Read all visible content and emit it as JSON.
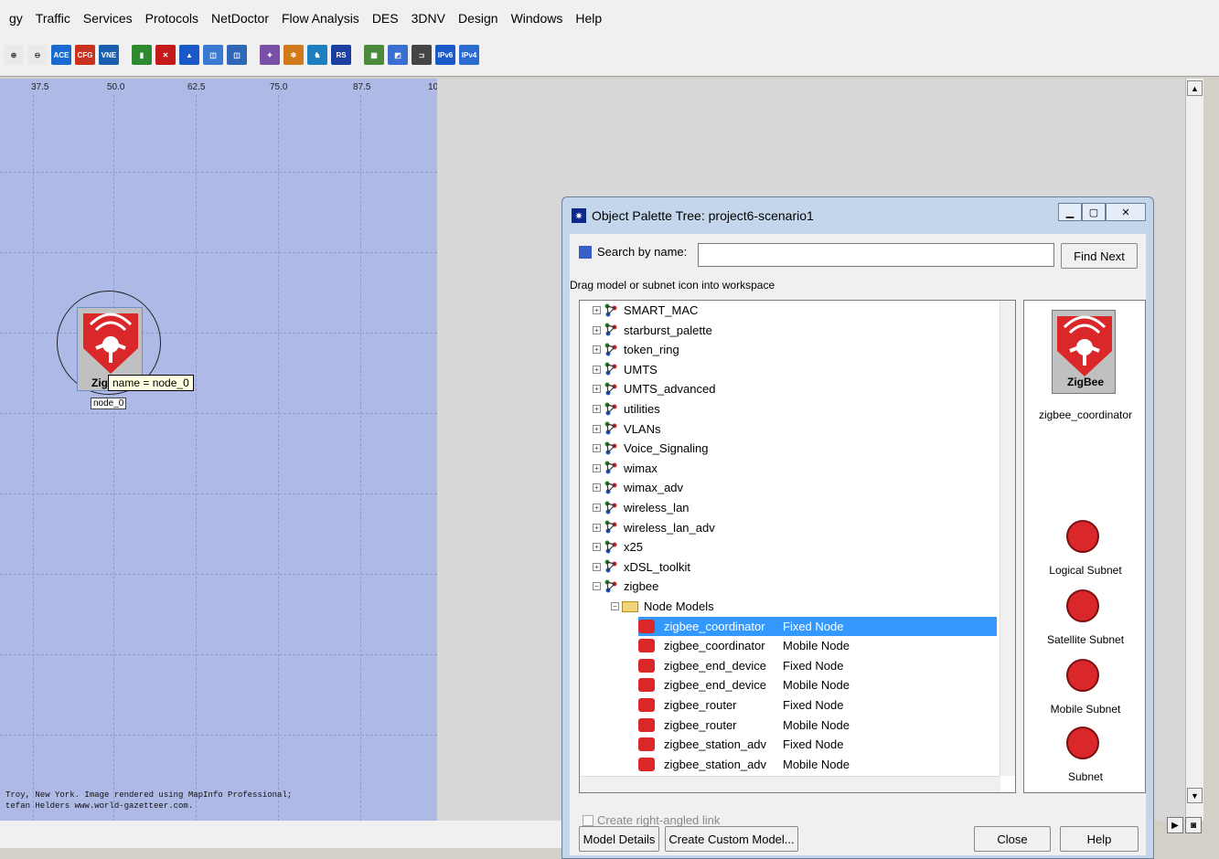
{
  "menu": [
    "gy",
    "Traffic",
    "Services",
    "Protocols",
    "NetDoctor",
    "Flow Analysis",
    "DES",
    "3DNV",
    "Design",
    "Windows",
    "Help"
  ],
  "toolbar": {
    "icons": [
      {
        "name": "zoom-in-icon",
        "color": "#eaeaea",
        "label": "⊕"
      },
      {
        "name": "zoom-out-icon",
        "color": "#eaeaea",
        "label": "⊖"
      },
      {
        "name": "ace-icon",
        "color": "#1a6bd1",
        "label": "ACE"
      },
      {
        "name": "cfg-icon",
        "color": "#c8321e",
        "label": "CFG"
      },
      {
        "name": "vne-icon",
        "color": "#1a5fb0",
        "label": "VNE"
      },
      {
        "name": "sep"
      },
      {
        "name": "traffic-light-icon",
        "color": "#2f8a2f",
        "label": "▮"
      },
      {
        "name": "fail-node-icon",
        "color": "#c61a1a",
        "label": "✕"
      },
      {
        "name": "triangle-icon",
        "color": "#1a58c8",
        "label": "▲"
      },
      {
        "name": "topology-icon",
        "color": "#3a7ad1",
        "label": "◫"
      },
      {
        "name": "topology-config-icon",
        "color": "#2e66b8",
        "label": "◫"
      },
      {
        "name": "sep"
      },
      {
        "name": "wand-icon",
        "color": "#7a4fa8",
        "label": "✦"
      },
      {
        "name": "network-icon",
        "color": "#d27a1a",
        "label": "✲"
      },
      {
        "name": "run-icon",
        "color": "#1e7fc0",
        "label": "♞"
      },
      {
        "name": "rs-icon",
        "color": "#1a3fa0",
        "label": "RS"
      },
      {
        "name": "sep"
      },
      {
        "name": "graph-icon",
        "color": "#4a8a3a",
        "label": "▦"
      },
      {
        "name": "chart-icon",
        "color": "#3a6fd1",
        "label": "◩"
      },
      {
        "name": "bracket-icon",
        "color": "#444444",
        "label": "⊐"
      },
      {
        "name": "ipv6-icon",
        "color": "#1a58c8",
        "label": "IPv6"
      },
      {
        "name": "ipv4-ipv6-icon",
        "color": "#2a6ad1",
        "label": "IPv4"
      }
    ]
  },
  "ruler": [
    "37.5",
    "50.0",
    "62.5",
    "75.0",
    "87.5",
    "10"
  ],
  "workspace": {
    "node_label": "node_0",
    "node_zig_text": "Zig",
    "tooltip": "name = node_0",
    "credits_1": "Troy, New York. Image rendered using MapInfo Professional;",
    "credits_2": "tefan Helders www.world-gazetteer.com."
  },
  "dialog": {
    "title": "Object Palette Tree: project6-scenario1",
    "search_label": "Search by name:",
    "search_value": "",
    "find_next": "Find Next",
    "hint": "Drag model or subnet icon into workspace",
    "palettes": [
      "SMART_MAC",
      "starburst_palette",
      "token_ring",
      "UMTS",
      "UMTS_advanced",
      "utilities",
      "VLANs",
      "Voice_Signaling",
      "wimax",
      "wimax_adv",
      "wireless_lan",
      "wireless_lan_adv",
      "x25",
      "xDSL_toolkit"
    ],
    "expanded_palette": "zigbee",
    "folder": "Node Models",
    "models": [
      {
        "name": "zigbee_coordinator",
        "type": "Fixed Node",
        "selected": true
      },
      {
        "name": "zigbee_coordinator",
        "type": "Mobile Node"
      },
      {
        "name": "zigbee_end_device",
        "type": "Fixed Node"
      },
      {
        "name": "zigbee_end_device",
        "type": "Mobile Node"
      },
      {
        "name": "zigbee_router",
        "type": "Fixed Node"
      },
      {
        "name": "zigbee_router",
        "type": "Mobile Node"
      },
      {
        "name": "zigbee_station_adv",
        "type": "Fixed Node"
      },
      {
        "name": "zigbee_station_adv",
        "type": "Mobile Node"
      }
    ],
    "preview": {
      "icon_text": "ZigBee",
      "name": "zigbee_coordinator",
      "subnets": [
        "Logical Subnet",
        "Satellite Subnet",
        "Mobile Subnet",
        "Subnet"
      ]
    },
    "checkbox_label": "Create right-angled link",
    "buttons": {
      "model_details": "Model Details",
      "create_custom": "Create Custom Model...",
      "close": "Close",
      "help": "Help"
    }
  }
}
